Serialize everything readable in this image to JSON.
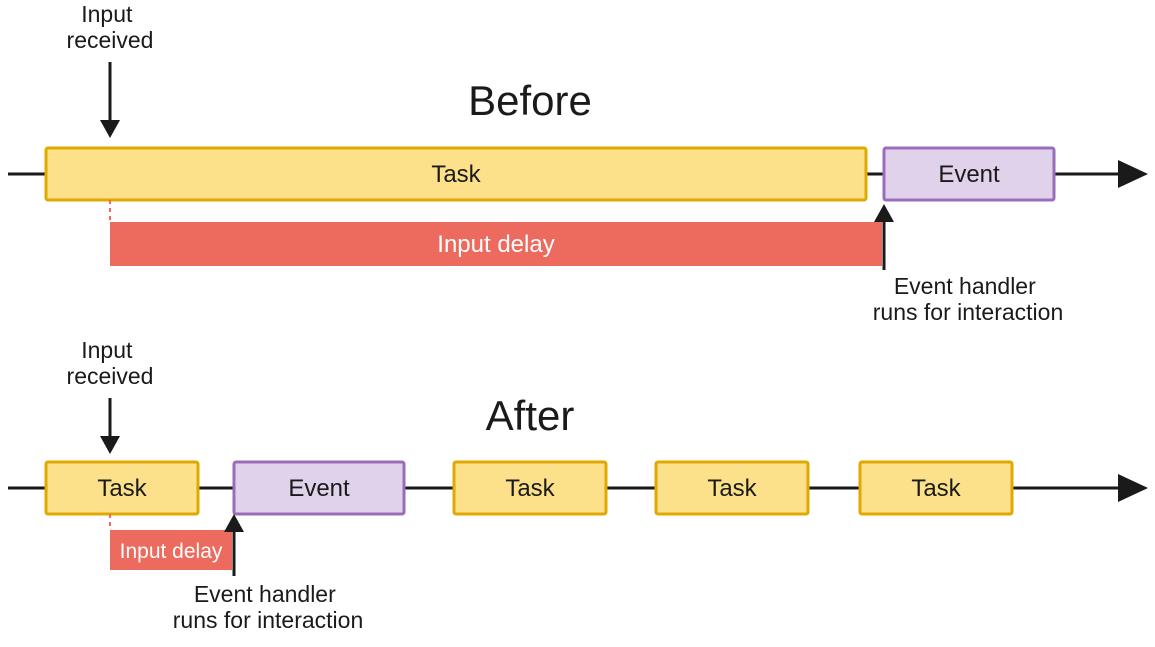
{
  "before": {
    "title": "Before",
    "inputReceived": "Input\nreceived",
    "task": "Task",
    "event": "Event",
    "inputDelay": "Input delay",
    "handlerCaption": "Event handler\nruns for interaction"
  },
  "after": {
    "title": "After",
    "inputReceived": "Input\nreceived",
    "tasks": [
      "Task",
      "Task",
      "Task",
      "Task"
    ],
    "event": "Event",
    "inputDelay": "Input delay",
    "handlerCaption": "Event handler\nruns for interaction"
  },
  "colors": {
    "task": "#FCE18A",
    "taskBorder": "#E0A800",
    "event": "#E1D2EB",
    "eventBorder": "#9A6DBB",
    "delay": "#EC6A5E",
    "ink": "#1a1a1a"
  }
}
